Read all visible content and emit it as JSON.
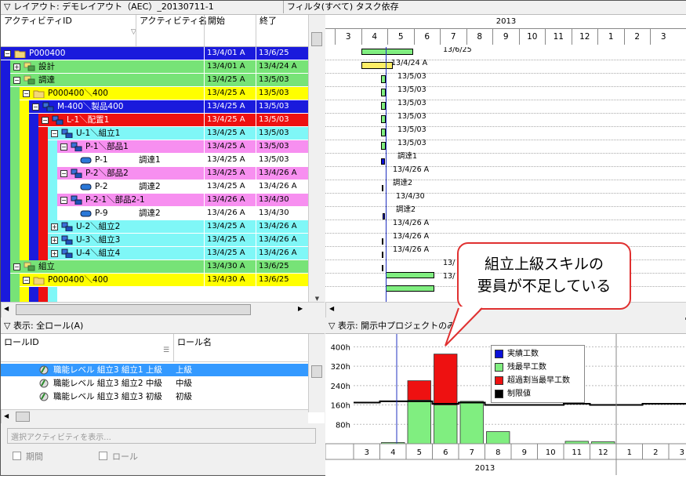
{
  "layout_bar": {
    "label": "▽ レイアウト: デモレイアウト（AEC）_20130711-1",
    "filter": "フィルタ(すべて) タスク依存"
  },
  "grid_header": {
    "col_id": "アクティビティID",
    "col_name": "アクティビティ名",
    "col_start": "開始",
    "col_finish": "終了"
  },
  "rows": [
    {
      "id": "P000400",
      "name": "",
      "start": "13/4/01 A",
      "finish": "13/6/25",
      "bg": "#1a1adc",
      "fg": "#fff",
      "indent": 0,
      "exp": "−",
      "icon": "folder"
    },
    {
      "id": "設計",
      "name": "",
      "start": "13/4/01 A",
      "finish": "13/4/24 A",
      "bg": "#77e377",
      "fg": "#000",
      "indent": 1,
      "exp": "+",
      "icon": "task"
    },
    {
      "id": "調達",
      "name": "",
      "start": "13/4/25 A",
      "finish": "13/5/03",
      "bg": "#77e377",
      "fg": "#000",
      "indent": 1,
      "exp": "−",
      "icon": "task"
    },
    {
      "id": "P000400＼400",
      "name": "",
      "start": "13/4/25 A",
      "finish": "13/5/03",
      "bg": "#ffff00",
      "fg": "#000",
      "indent": 2,
      "exp": "−",
      "icon": "folder"
    },
    {
      "id": "M-400＼製品400",
      "name": "",
      "start": "13/4/25 A",
      "finish": "13/5/03",
      "bg": "#1a1adc",
      "fg": "#fff",
      "indent": 3,
      "exp": "−",
      "icon": "wbs"
    },
    {
      "id": "L-1＼配置1",
      "name": "",
      "start": "13/4/25 A",
      "finish": "13/5/03",
      "bg": "#ee1111",
      "fg": "#fff",
      "indent": 4,
      "exp": "−",
      "icon": "wbs"
    },
    {
      "id": "U-1＼組立1",
      "name": "",
      "start": "13/4/25 A",
      "finish": "13/5/03",
      "bg": "#7ff7f7",
      "fg": "#000",
      "indent": 5,
      "exp": "−",
      "icon": "wbs"
    },
    {
      "id": "P-1＼部品1",
      "name": "",
      "start": "13/4/25 A",
      "finish": "13/5/03",
      "bg": "#f78ff0",
      "fg": "#000",
      "indent": 6,
      "exp": "−",
      "icon": "wbs"
    },
    {
      "id": "P-1",
      "name": "調達1",
      "start": "13/4/25 A",
      "finish": "13/5/03",
      "bg": "#ffffff",
      "fg": "#000",
      "indent": 7,
      "exp": "",
      "icon": "act"
    },
    {
      "id": "P-2＼部品2",
      "name": "",
      "start": "13/4/25 A",
      "finish": "13/4/26 A",
      "bg": "#f78ff0",
      "fg": "#000",
      "indent": 6,
      "exp": "−",
      "icon": "wbs"
    },
    {
      "id": "P-2",
      "name": "調達2",
      "start": "13/4/25 A",
      "finish": "13/4/26 A",
      "bg": "#ffffff",
      "fg": "#000",
      "indent": 7,
      "exp": "",
      "icon": "act"
    },
    {
      "id": "P-2-1＼部品2-1",
      "name": "",
      "start": "13/4/26 A",
      "finish": "13/4/30",
      "bg": "#f78ff0",
      "fg": "#000",
      "indent": 6,
      "exp": "−",
      "icon": "wbs"
    },
    {
      "id": "P-9",
      "name": "調達2",
      "start": "13/4/26 A",
      "finish": "13/4/30",
      "bg": "#ffffff",
      "fg": "#000",
      "indent": 7,
      "exp": "",
      "icon": "act"
    },
    {
      "id": "U-2＼組立2",
      "name": "",
      "start": "13/4/25 A",
      "finish": "13/4/26 A",
      "bg": "#7ff7f7",
      "fg": "#000",
      "indent": 5,
      "exp": "+",
      "icon": "wbs"
    },
    {
      "id": "U-3＼組立3",
      "name": "",
      "start": "13/4/25 A",
      "finish": "13/4/26 A",
      "bg": "#7ff7f7",
      "fg": "#000",
      "indent": 5,
      "exp": "+",
      "icon": "wbs"
    },
    {
      "id": "U-4＼組立4",
      "name": "",
      "start": "13/4/25 A",
      "finish": "13/4/26 A",
      "bg": "#7ff7f7",
      "fg": "#000",
      "indent": 5,
      "exp": "+",
      "icon": "wbs"
    },
    {
      "id": "組立",
      "name": "",
      "start": "13/4/30 A",
      "finish": "13/6/25",
      "bg": "#77e377",
      "fg": "#000",
      "indent": 1,
      "exp": "−",
      "icon": "task"
    },
    {
      "id": "P000400＼400",
      "name": "",
      "start": "13/4/30 A",
      "finish": "13/6/25",
      "bg": "#ffff00",
      "fg": "#000",
      "indent": 2,
      "exp": "−",
      "icon": "folder"
    }
  ],
  "gantt": {
    "year": "2013",
    "months": [
      "3",
      "4",
      "5",
      "6",
      "7",
      "8",
      "9",
      "10",
      "11",
      "12",
      "1",
      "2",
      "3"
    ],
    "labels": [
      "13/6/25",
      "13/4/24 A",
      "13/5/03",
      "13/5/03",
      "13/5/03",
      "13/5/03",
      "13/5/03",
      "13/5/03",
      "調達1",
      "13/4/26 A",
      "調達2",
      "13/4/30",
      "調達2",
      "13/4/26 A",
      "13/4/26 A",
      "13/4/26 A",
      "13/",
      "13/"
    ]
  },
  "role_panel": {
    "header": "▽ 表示: 全ロール(A)",
    "col_id": "ロールID",
    "col_name": "ロール名",
    "roles": [
      {
        "id": "職能レベル 組立3 組立1 上級",
        "name": "上級"
      },
      {
        "id": "職能レベル 組立3 組立2 中級",
        "name": "中級"
      },
      {
        "id": "職能レベル 組立3 組立3 初級",
        "name": "初級"
      }
    ],
    "show_activity": "選択アクティビティを表示...",
    "period": "期間",
    "role": "ロール"
  },
  "hist_panel": {
    "header": "▽ 表示: 開示中プロジェクトのみ",
    "y_ticks": [
      "400h",
      "320h",
      "240h",
      "160h",
      "80h"
    ],
    "legend": [
      {
        "label": "実績工数",
        "color": "#0a10d8"
      },
      {
        "label": "残最早工数",
        "color": "#80ee80"
      },
      {
        "label": "超過割当最早工数",
        "color": "#ee1111"
      },
      {
        "label": "制限値",
        "color": "#000000"
      }
    ]
  },
  "chart_data": {
    "type": "bar",
    "categories": [
      "3",
      "4",
      "5",
      "6",
      "7",
      "8",
      "9",
      "10",
      "11",
      "12",
      "1",
      "2",
      "3"
    ],
    "series": [
      {
        "name": "残最早工数",
        "values": [
          0,
          5,
          180,
          160,
          175,
          50,
          0,
          0,
          10,
          8,
          0,
          0,
          0
        ]
      },
      {
        "name": "超過割当最早工数",
        "values": [
          0,
          0,
          80,
          210,
          0,
          0,
          0,
          0,
          0,
          0,
          0,
          0,
          0
        ]
      },
      {
        "name": "制限値",
        "values": [
          170,
          175,
          175,
          165,
          170,
          160,
          160,
          160,
          165,
          160,
          160,
          165,
          165
        ]
      }
    ],
    "ylim": [
      0,
      440
    ],
    "xlabel": "2013"
  },
  "callout": {
    "line1": "組立上級スキルの",
    "line2": "要員が不足している"
  }
}
